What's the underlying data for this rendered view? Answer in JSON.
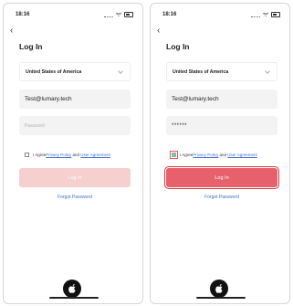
{
  "status": {
    "time": "18:16"
  },
  "title": "Log In",
  "country": "United States of America",
  "email_value": "Test@lumary.tech",
  "password_placeholder": "Password",
  "password_masked": "******",
  "agree": {
    "prefix": "I Agree",
    "privacy": "Privacy Policy",
    "and": " and ",
    "user": "User Agreement"
  },
  "login_label": "Log In",
  "forgot_label": "Forgot Password",
  "colors": {
    "accent": "#e6616b",
    "accent_disabled": "#f6cfcf",
    "link": "#3f6fc8",
    "checkbox_checked": "#7ec0a7"
  },
  "screens": [
    {
      "state": "empty",
      "password_filled": false,
      "agreement_checked": false,
      "login_enabled": false
    },
    {
      "state": "filled",
      "password_filled": true,
      "agreement_checked": true,
      "login_enabled": true
    }
  ]
}
